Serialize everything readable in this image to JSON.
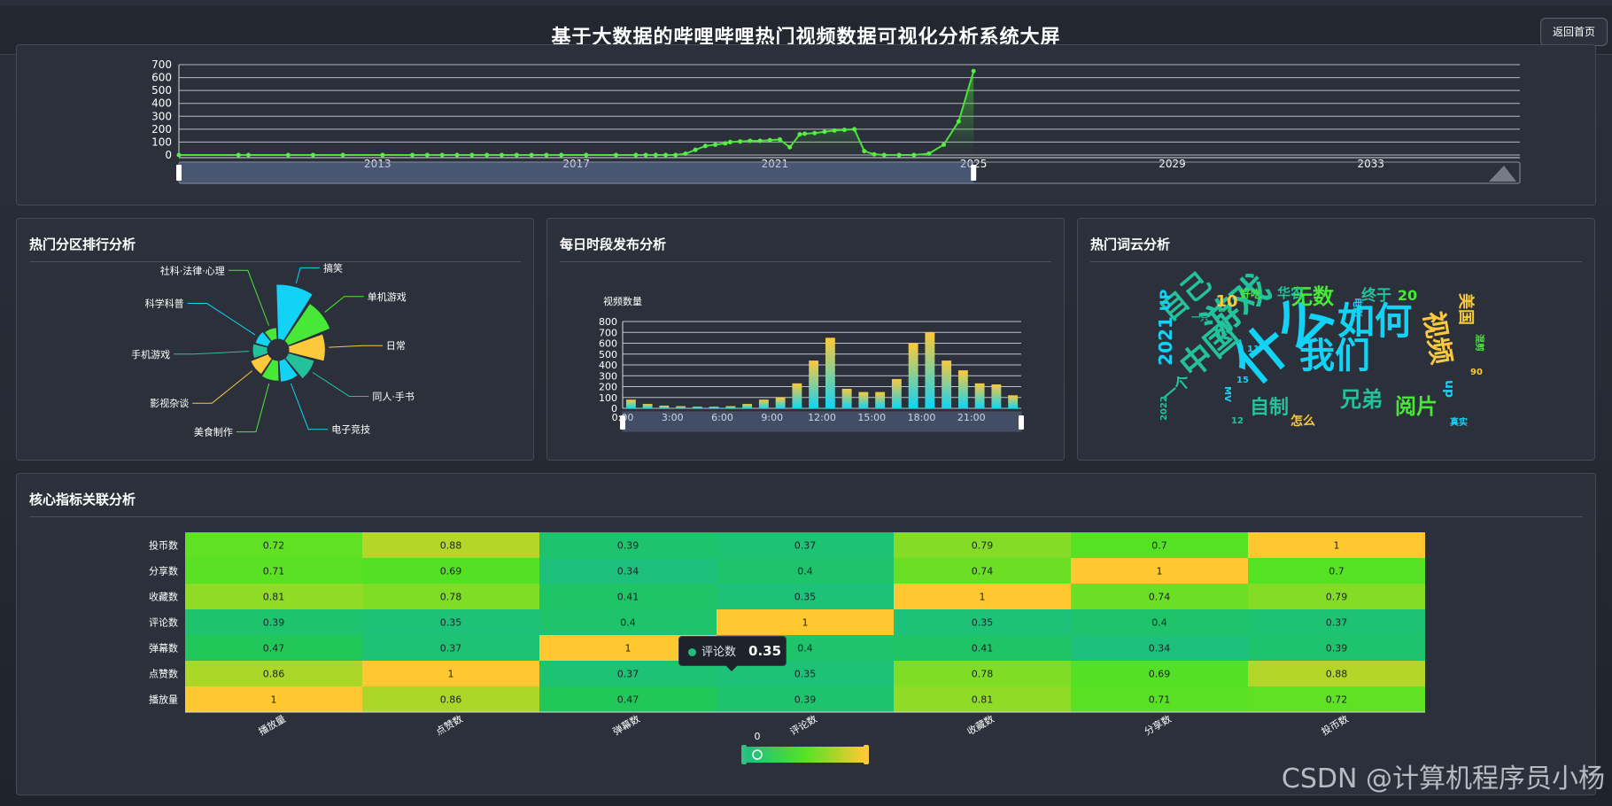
{
  "header": {
    "title": "基于大数据的哔哩哔哩热门视频数据可视化分析系统大屏",
    "back_label": "返回首页"
  },
  "panels": {
    "category": "热门分区排行分析",
    "hourly": "每日时段发布分析",
    "wordcloud": "热门词云分析",
    "heatmap": "核心指标关联分析"
  },
  "watermark": "CSDN @计算机程序员小杨",
  "chart_data": [
    {
      "id": "timeline",
      "type": "line",
      "ylim": [
        0,
        700
      ],
      "yticks": [
        0,
        100,
        200,
        300,
        400,
        500,
        600,
        700
      ],
      "xlim": [
        2009,
        2036
      ],
      "xticks": [
        2013,
        2017,
        2021,
        2025,
        2029,
        2033
      ],
      "zoom_window": [
        2009,
        2025
      ],
      "x": [
        2009.0,
        2010.2,
        2010.4,
        2011.2,
        2011.7,
        2012.3,
        2013.1,
        2013.7,
        2014.0,
        2014.3,
        2014.6,
        2014.9,
        2015.2,
        2015.5,
        2015.8,
        2016.1,
        2016.4,
        2016.7,
        2017.2,
        2017.8,
        2018.2,
        2018.4,
        2018.6,
        2018.8,
        2019.0,
        2019.2,
        2019.4,
        2019.6,
        2019.8,
        2020.0,
        2020.1,
        2020.3,
        2020.5,
        2020.7,
        2020.9,
        2021.1,
        2021.3,
        2021.5,
        2021.6,
        2021.8,
        2022.0,
        2022.2,
        2022.4,
        2022.6,
        2022.8,
        2023.0,
        2023.2,
        2023.5,
        2023.8,
        2024.1,
        2024.4,
        2024.7,
        2025.0
      ],
      "values": [
        0,
        0,
        0,
        0,
        0,
        0,
        0,
        0,
        0,
        0,
        0,
        0,
        0,
        0,
        0,
        0,
        0,
        0,
        0,
        0,
        0,
        0,
        0,
        0,
        0,
        10,
        40,
        70,
        80,
        90,
        100,
        105,
        110,
        110,
        115,
        120,
        60,
        160,
        165,
        170,
        180,
        190,
        195,
        200,
        30,
        5,
        0,
        0,
        0,
        10,
        80,
        260,
        650
      ]
    },
    {
      "id": "category",
      "type": "pie",
      "categories": [
        "搞笑",
        "单机游戏",
        "日常",
        "同人·手书",
        "电子竞技",
        "美食制作",
        "影视杂谈",
        "手机游戏",
        "科学科普",
        "社科·法律·心理"
      ],
      "values": [
        100,
        88,
        75,
        60,
        50,
        48,
        45,
        36,
        32,
        28
      ]
    },
    {
      "id": "hourly",
      "type": "bar",
      "ylabel": "视频数量",
      "ylim": [
        0,
        800
      ],
      "yticks": [
        0,
        100,
        200,
        300,
        400,
        500,
        600,
        700,
        800
      ],
      "xticks": [
        "0:00",
        "3:00",
        "6:00",
        "9:00",
        "12:00",
        "15:00",
        "18:00",
        "21:00"
      ],
      "categories": [
        "0",
        "1",
        "2",
        "3",
        "4",
        "5",
        "6",
        "7",
        "8",
        "9",
        "10",
        "11",
        "12",
        "13",
        "14",
        "15",
        "16",
        "17",
        "18",
        "19",
        "20",
        "21",
        "22",
        "23"
      ],
      "values": [
        80,
        40,
        25,
        20,
        15,
        15,
        20,
        40,
        80,
        100,
        230,
        440,
        650,
        180,
        150,
        150,
        270,
        600,
        700,
        440,
        350,
        230,
        220,
        120
      ]
    },
    {
      "id": "wordcloud",
      "type": "other",
      "words": [
        "什么",
        "游戏",
        "如何",
        "中国",
        "我们",
        "自己",
        "视频",
        "无数",
        "兄弟",
        "阅片",
        "自制",
        "2021",
        "UP",
        "终于",
        "20",
        "美国",
        "好吃",
        "华农",
        "10",
        "电影",
        "一只",
        "11",
        "15",
        "混剪",
        "一个",
        "2022",
        "12",
        "怎么",
        "真实",
        "up",
        "90",
        "MV"
      ]
    },
    {
      "id": "heatmap",
      "type": "heatmap",
      "categories": [
        "播放量",
        "点赞数",
        "弹幕数",
        "评论数",
        "收藏数",
        "分享数",
        "投币数"
      ],
      "rows": [
        "投币数",
        "分享数",
        "收藏数",
        "评论数",
        "弹幕数",
        "点赞数",
        "播放量"
      ],
      "values": [
        [
          0.72,
          0.88,
          0.39,
          0.37,
          0.79,
          0.7,
          1
        ],
        [
          0.71,
          0.69,
          0.34,
          0.4,
          0.74,
          1,
          0.7
        ],
        [
          0.81,
          0.78,
          0.41,
          0.35,
          1,
          0.74,
          0.79
        ],
        [
          0.39,
          0.35,
          0.4,
          1,
          0.35,
          0.4,
          0.37
        ],
        [
          0.47,
          0.37,
          1,
          0.4,
          0.41,
          0.34,
          0.39
        ],
        [
          0.86,
          1,
          0.37,
          0.35,
          0.78,
          0.69,
          0.88
        ],
        [
          1,
          0.86,
          0.47,
          0.39,
          0.81,
          0.71,
          0.72
        ]
      ],
      "visualmap_min": "0",
      "tooltip_label": "评论数",
      "tooltip_value": "0.35"
    }
  ]
}
